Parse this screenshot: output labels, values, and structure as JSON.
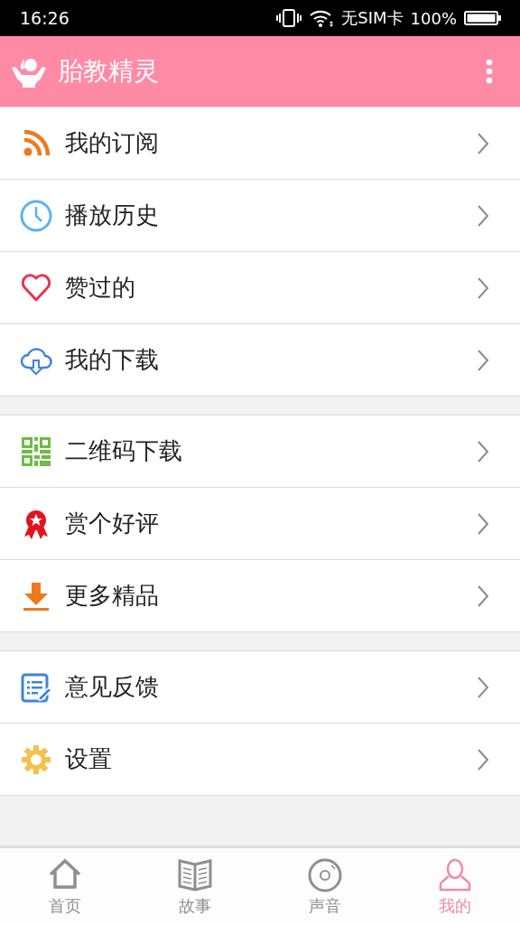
{
  "status_bar": {
    "time": "16:26",
    "carrier": "无SIM卡",
    "battery": "100%"
  },
  "app_bar": {
    "title": "胎教精灵"
  },
  "menu_groups": [
    [
      {
        "kind": "rss",
        "label": "我的订阅"
      },
      {
        "kind": "clock",
        "label": "播放历史"
      },
      {
        "kind": "heart",
        "label": "赞过的"
      },
      {
        "kind": "cloud",
        "label": "我的下载"
      }
    ],
    [
      {
        "kind": "qr",
        "label": "二维码下载"
      },
      {
        "kind": "ribbon",
        "label": "赏个好评"
      },
      {
        "kind": "download",
        "label": "更多精品"
      }
    ],
    [
      {
        "kind": "feedback",
        "label": "意见反馈"
      },
      {
        "kind": "gear",
        "label": "设置"
      }
    ]
  ],
  "tabs": [
    {
      "kind": "home",
      "label": "首页",
      "selected": false
    },
    {
      "kind": "book",
      "label": "故事",
      "selected": false
    },
    {
      "kind": "disc",
      "label": "声音",
      "selected": false
    },
    {
      "kind": "person",
      "label": "我的",
      "selected": true
    }
  ]
}
